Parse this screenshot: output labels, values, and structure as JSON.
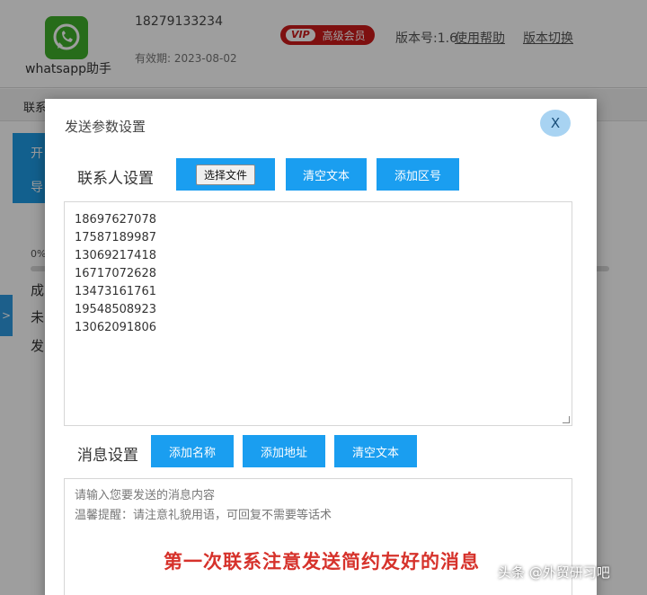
{
  "header": {
    "app_name": "whatsapp助手",
    "phone": "18279133234",
    "expiry": "有效期: 2023-08-02",
    "vip_tag": "VIP",
    "vip_label": "高级会员",
    "version": "版本号:1.6",
    "help_link": "使用帮助",
    "switch_link": "版本切换"
  },
  "background": {
    "tab_contacts": "联系",
    "side_line1": "开",
    "side_line2": "导",
    "progress_label": "0%",
    "stat1": "成",
    "stat2": "未",
    "stat3": "发",
    "collapse_arrow": ">"
  },
  "modal": {
    "title": "发送参数设置",
    "close_label": "X",
    "contacts": {
      "label": "联系人设置",
      "choose_file": "选择文件",
      "clear_text": "清空文本",
      "add_area_code": "添加区号",
      "numbers": [
        "18697627078",
        "17587189987",
        "13069217418",
        "16717072628",
        "13473161761",
        "19548508923",
        "13062091806"
      ]
    },
    "message": {
      "label": "消息设置",
      "add_name": "添加名称",
      "add_address": "添加地址",
      "clear_text": "清空文本",
      "placeholder_line1": "请输入您要发送的消息内容",
      "placeholder_line2": "温馨提醒：请注意礼貌用语，可回复不需要等话术",
      "red_note": "第一次联系注意发送简约友好的消息"
    }
  },
  "watermark": "头条 @外贸研习吧",
  "colors": {
    "accent": "#1a9ef0",
    "vip_red": "#cc1a1a",
    "note_red": "#d6322b",
    "logo_green": "#3fae2a"
  }
}
